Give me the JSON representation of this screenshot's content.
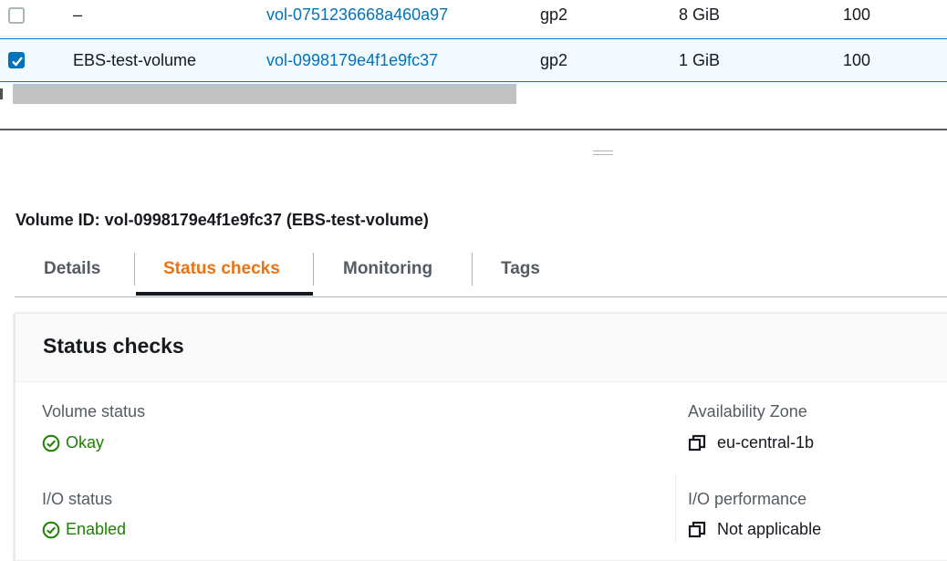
{
  "table": {
    "rows": [
      {
        "checked": false,
        "name": "–",
        "volume_id": "vol-0751236668a460a97",
        "type": "gp2",
        "size": "8 GiB",
        "iops": "100"
      },
      {
        "checked": true,
        "name": "EBS-test-volume",
        "volume_id": "vol-0998179e4f1e9fc37",
        "type": "gp2",
        "size": "1 GiB",
        "iops": "100"
      }
    ]
  },
  "details": {
    "title": "Volume ID: vol-0998179e4f1e9fc37 (EBS-test-volume)",
    "tabs": [
      {
        "label": "Details",
        "active": false
      },
      {
        "label": "Status checks",
        "active": true
      },
      {
        "label": "Monitoring",
        "active": false
      },
      {
        "label": "Tags",
        "active": false
      }
    ]
  },
  "status_panel": {
    "title": "Status checks",
    "volume_status_label": "Volume status",
    "volume_status_value": "Okay",
    "io_status_label": "I/O status",
    "io_status_value": "Enabled",
    "availability_zone_label": "Availability Zone",
    "availability_zone_value": "eu-central-1b",
    "io_performance_label": "I/O performance",
    "io_performance_value": "Not applicable"
  },
  "colors": {
    "link": "#0073bb",
    "active_tab": "#ec7211",
    "success": "#1d8102",
    "selected_row_bg": "#f1faff"
  },
  "icons": {
    "status_ok": "check-circle-icon",
    "copy": "copy-icon",
    "checkbox_checked": "checkbox-checked-icon"
  }
}
